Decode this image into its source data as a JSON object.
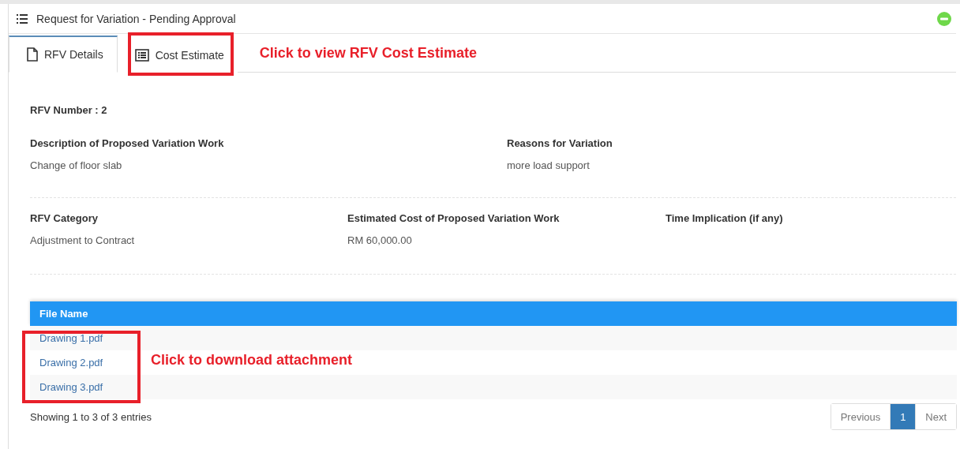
{
  "panel": {
    "title": "Request for Variation - Pending Approval"
  },
  "tabs": [
    {
      "label": "RFV Details",
      "kind": "document",
      "selected": true
    },
    {
      "label": "Cost Estimate",
      "kind": "list",
      "selected": false
    }
  ],
  "tab_annotation": "Click to view RFV Cost Estimate",
  "rfv_number": "RFV Number : 2",
  "field_rows": [
    [
      {
        "label": "Description of Proposed Variation Work",
        "value": "Change of floor slab"
      },
      {
        "label": "Reasons for Variation",
        "value": "more load support"
      }
    ],
    [
      {
        "label": "RFV Category",
        "value": "Adjustment to Contract"
      },
      {
        "label": "Estimated Cost of Proposed Variation Work",
        "value": "RM 60,000.00"
      },
      {
        "label": "Time Implication (if any)"
      }
    ]
  ],
  "table": {
    "columns": [
      "File Name"
    ],
    "rows": [
      "Drawing 1.pdf",
      "Drawing 2.pdf",
      "Drawing 3.pdf"
    ]
  },
  "table_annotation": "Click to download attachment",
  "info": "Showing 1 to 3 of 3 entries",
  "pagination": [
    {
      "label": "Previous",
      "kind": "nav",
      "selected": false
    },
    {
      "label": "1",
      "kind": "page",
      "selected": true
    },
    {
      "label": "Next",
      "kind": "nav",
      "selected": false
    }
  ]
}
